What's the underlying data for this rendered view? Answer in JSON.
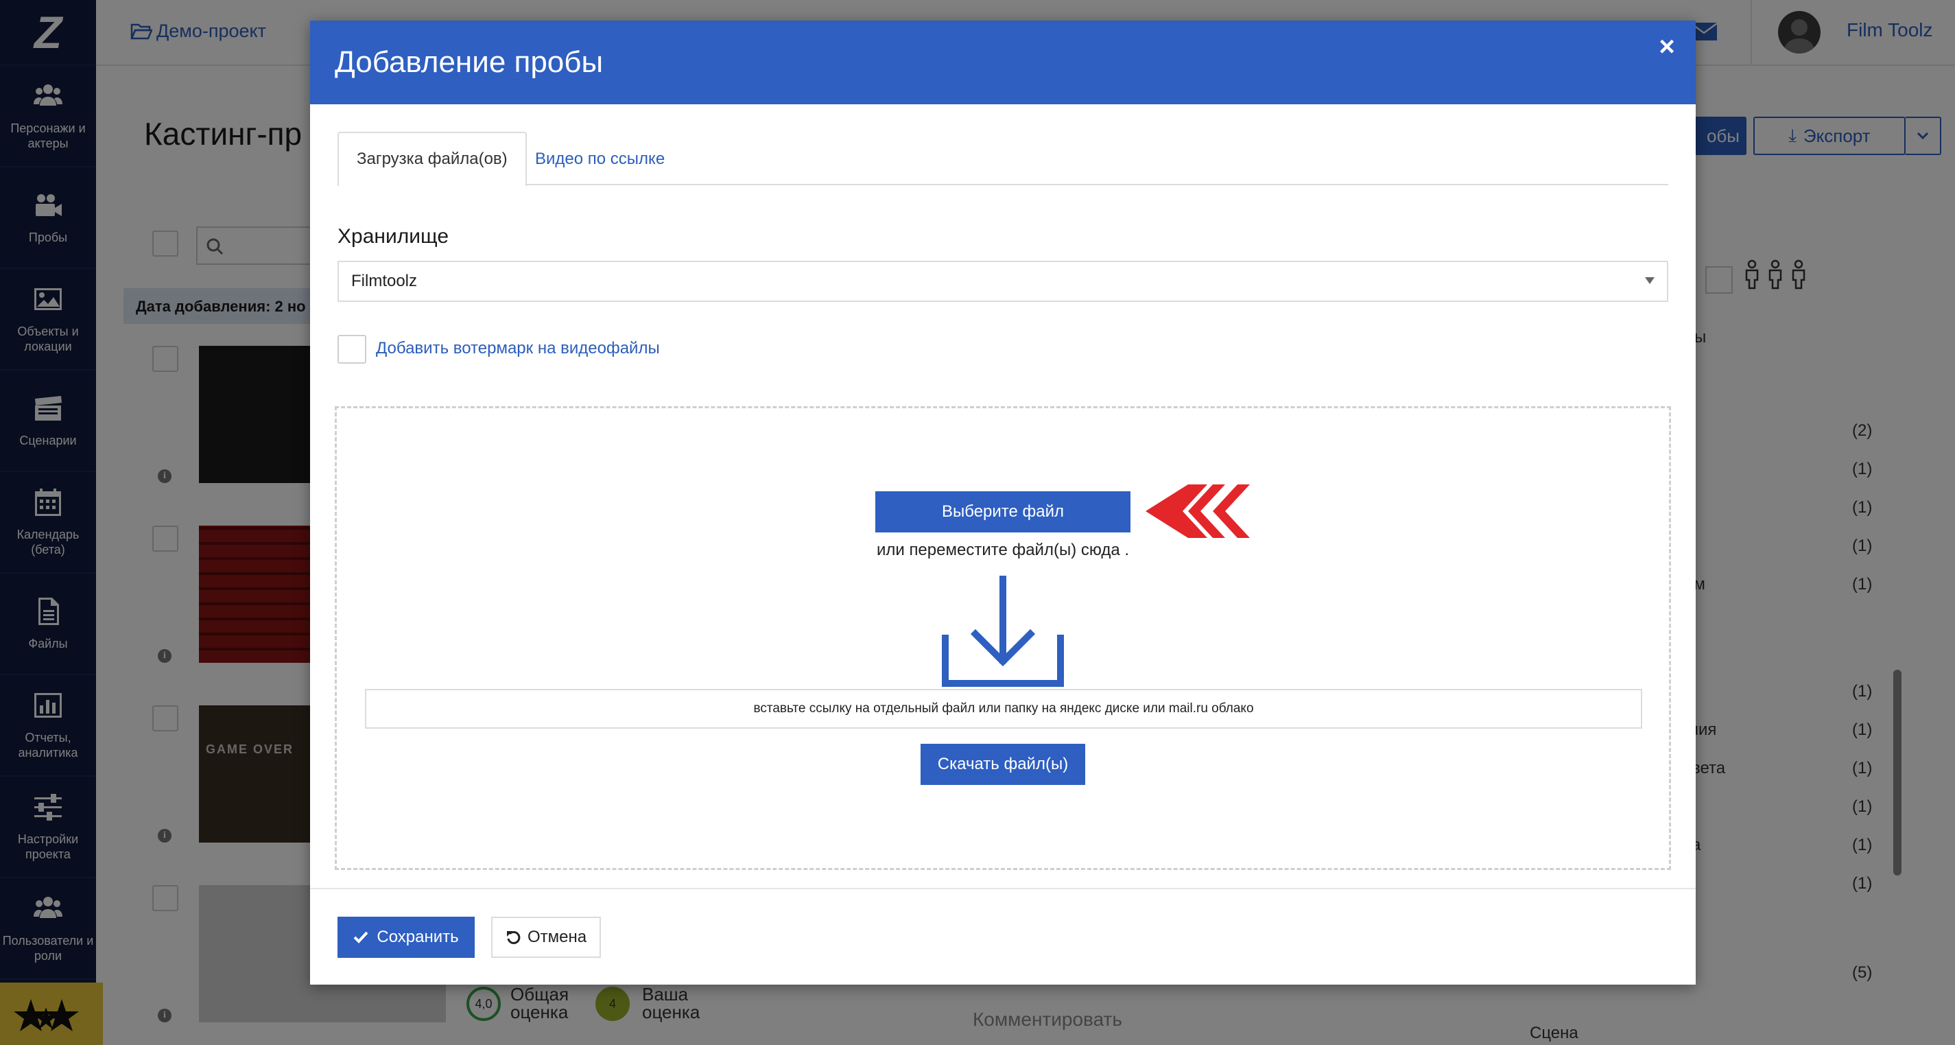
{
  "sidebar": {
    "logo": "Z",
    "items": [
      {
        "label": "Персонажи и\nактеры",
        "icon": "people-icon"
      },
      {
        "label": "Пробы",
        "icon": "video-camera-icon"
      },
      {
        "label": "Объекты и\nлокации",
        "icon": "image-icon"
      },
      {
        "label": "Сценарии",
        "icon": "clapperboard-icon"
      },
      {
        "label": "Календарь\n(бета)",
        "icon": "calendar-icon"
      },
      {
        "label": "Файлы",
        "icon": "file-icon"
      },
      {
        "label": "Отчеты,\nаналитика",
        "icon": "chart-icon"
      },
      {
        "label": "Настройки\nпроекта",
        "icon": "sliders-icon"
      },
      {
        "label": "Пользователи и\nроли",
        "icon": "users-icon"
      }
    ]
  },
  "topbar": {
    "project": "Демо-проект",
    "user": "Film Toolz"
  },
  "background": {
    "page_title": "Кастинг-пр",
    "probes_button_fragment": "обы",
    "export_button": "Экспорт",
    "date_bar": "Дата добавления: 2 но",
    "rating_value": "4,0",
    "rating_label": "Общая\nоценка",
    "my_rating_value": "4",
    "my_rating_label": "Ваша\nоценка",
    "comment_placeholder": "Комментировать",
    "scene_label": "Сцена",
    "right_fragments": [
      "ы",
      "ом",
      "лия",
      "вета",
      "а"
    ],
    "right_counts": [
      "(2)",
      "(1)",
      "(1)",
      "(1)",
      "(1)",
      "(1)",
      "(1)",
      "(1)",
      "(1)",
      "(1)",
      "(1)",
      "(5)"
    ],
    "thumb_caption": "GAME OVER"
  },
  "modal": {
    "title": "Добавление пробы",
    "close": "×",
    "tabs": [
      {
        "label": "Загрузка файла(ов)",
        "active": true
      },
      {
        "label": "Видео по ссылке",
        "active": false
      }
    ],
    "storage_label": "Хранилище",
    "storage_value": "Filmtoolz",
    "watermark_label": "Добавить вотермарк на видеофайлы",
    "choose_file": "Выберите файл",
    "drop_text": "или переместите файл(ы) сюда .",
    "link_placeholder": "вставьте ссылку на отдельный файл или папку на яндекс диске или mail.ru облако",
    "fetch_button": "Скачать файл(ы)",
    "save_button": "Сохранить",
    "cancel_button": "Отмена"
  },
  "colors": {
    "sidebar_bg": "#101a3e",
    "primary": "#2e5fc1",
    "link": "#2c5ebc",
    "arrow_red": "#e3262a",
    "badge_yellow": "#e8c73a"
  }
}
